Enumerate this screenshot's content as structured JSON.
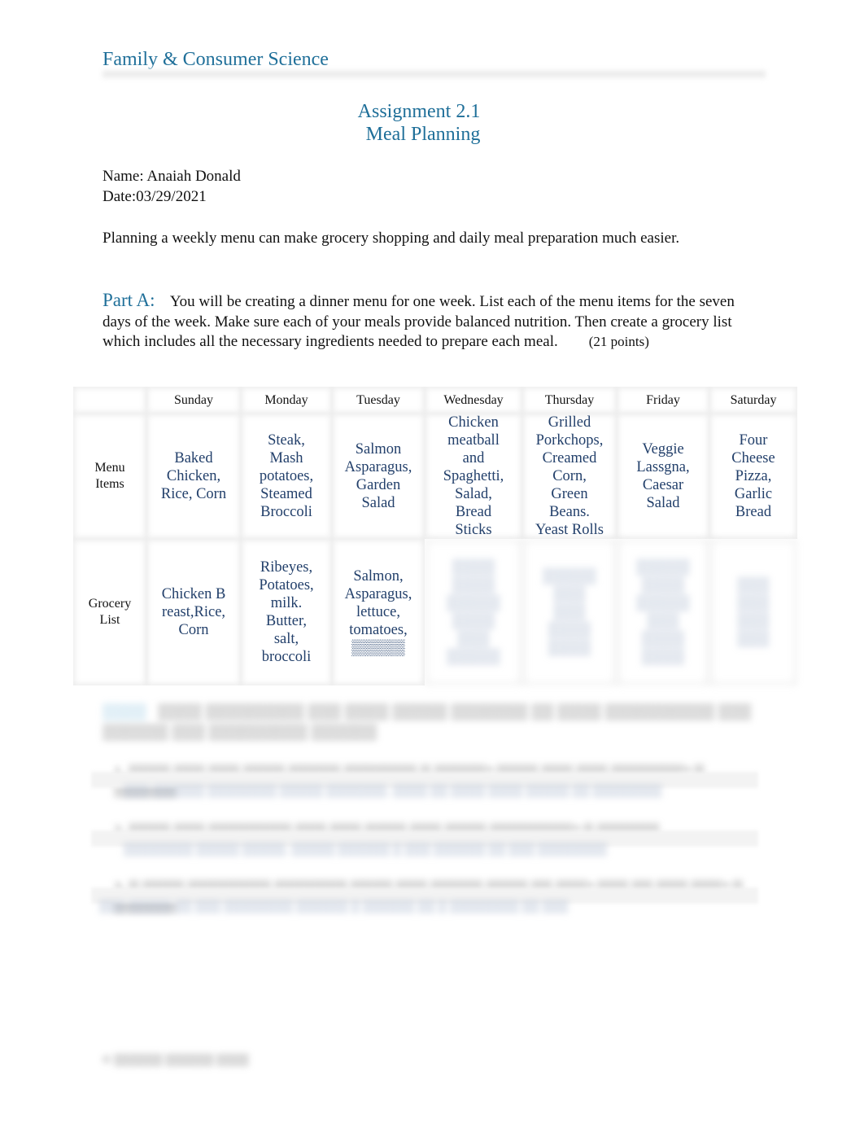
{
  "header": {
    "course": "Family & Consumer Science",
    "assignment": "Assignment 2.1",
    "topic": "Meal Planning"
  },
  "student": {
    "name_line": "Name: Anaiah Donald",
    "date_line": "Date:03/29/2021"
  },
  "intro": "Planning a weekly menu can make grocery shopping and daily meal preparation much easier.",
  "part_a": {
    "label": "Part A:",
    "text": "You will be creating a dinner menu for one week.         List each of the menu items for the seven days of the week.        Make sure each of your meals provide balanced nutrition.  Then create a grocery list which includes all the necessary ingredients needed to prepare each meal.",
    "points": "(21 points)"
  },
  "table": {
    "days": [
      "Sunday",
      "Monday",
      "Tuesday",
      "Wednesday",
      "Thursday",
      "Friday",
      "Saturday"
    ],
    "row_labels": {
      "menu": "Menu Items",
      "grocery": "Grocery List"
    },
    "menu_items": [
      "Baked Chicken, Rice, Corn",
      "Steak, Mash potatoes, Steamed Broccoli",
      "Salmon Asparagus, Garden Salad",
      "Chicken meatball and Spaghetti, Salad, Bread Sticks",
      "Grilled Porkchops, Creamed Corn, Green Beans. Yeast Rolls",
      "Veggie Lassgna, Caesar Salad",
      "Four Cheese Pizza, Garlic Bread"
    ],
    "grocery_list": [
      "Chicken Breast,Rice,Corn",
      "Ribeyes, Potatoes, milk. Butter, salt, broccoli",
      "Salmon, Asparagus, lettuce, tomatoes, ▒▒▒▒▒",
      "▒▒▒▒ ▒▒▒▒ ▒▒▒▒▒ ▒▒▒▒ ▒▒▒ ▒▒▒▒▒",
      "▒▒▒▒▒ ▒▒▒ ▒▒▒ ▒▒▒▒ ▒▒▒▒",
      "▒▒▒▒▒ ▒▒▒▒ ▒▒▒▒▒ ▒▒▒ ▒▒▒▒ ▒▒▒▒",
      "▒▒▒ ▒▒▒ ▒▒▒ ▒▒▒"
    ]
  },
  "part_b": {
    "label": "▒▒▒▒",
    "text": "▒▒▒▒ ▒▒▒▒▒▒▒▒▒ ▒▒▒ ▒▒▒▒ ▒▒▒▒▒ ▒▒▒▒▒▒▒ ▒▒ ▒▒▒▒ ▒▒▒▒▒▒▒▒▒▒ ▒▒▒ ▒▒▒▒▒▒ ▒▒▒ ▒▒▒▒▒▒▒▒▒ ▒▒▒▒▒▒",
    "questions": [
      {
        "q": "1. ▒▒▒▒ ▒▒▒ ▒▒▒ ▒▒▒▒ ▒▒▒▒▒ ▒▒▒▒▒▒▒ ▒ ▒▒▒▒▒? ▒▒▒▒ ▒▒▒ ▒▒▒ ▒▒▒▒▒▒▒?   ▒ ▒▒▒▒▒▒",
        "a": "▒▒▒ ▒▒▒▒▒▒ ▒▒▒▒▒▒▒▒ ▒▒▒▒▒ ▒▒▒▒▒▒▒. ▒▒▒▒ ▒▒ ▒▒▒▒ ▒▒▒▒ ▒▒▒▒▒ ▒▒ ▒▒▒▒▒▒▒▒"
      },
      {
        "q": "2. ▒▒▒▒ ▒▒▒ ▒▒▒▒▒▒▒▒ ▒▒▒ ▒▒▒ ▒▒▒▒ ▒▒▒ ▒▒▒▒ ▒▒▒▒▒▒▒▒?   ▒ ▒▒▒▒▒▒",
        "a": "▒▒▒▒▒▒▒▒ ▒▒▒▒▒ ▒▒▒▒▒. ▒▒▒▒▒ ▒▒▒▒▒▒ ▒ ▒▒▒ ▒▒▒▒▒▒ ▒▒ ▒▒▒ ▒▒▒▒▒▒▒▒"
      },
      {
        "q": "3. ▒ ▒▒▒▒ ▒▒▒▒▒▒▒▒ ▒▒▒▒▒▒▒ ▒▒▒▒ ▒▒▒ ▒▒▒▒▒ ▒▒▒▒ ▒▒ ▒▒▒?   ▒▒▒ ▒▒ ▒▒▒ ▒▒▒?   ▒ ▒▒▒▒▒▒",
        "a": "▒▒▒ ▒▒▒▒▒ ▒▒ ▒▒▒ ▒▒▒▒▒▒▒▒ ▒▒▒▒▒▒ ▒ ▒▒▒▒▒▒ ▒▒ ▒ ▒▒▒▒▒▒▒▒ ▒▒ ▒▒▒"
      }
    ]
  },
  "footer": "© ▒▒▒▒▒▒ ▒▒▒▒▒▒ ▒▒▒▒"
}
